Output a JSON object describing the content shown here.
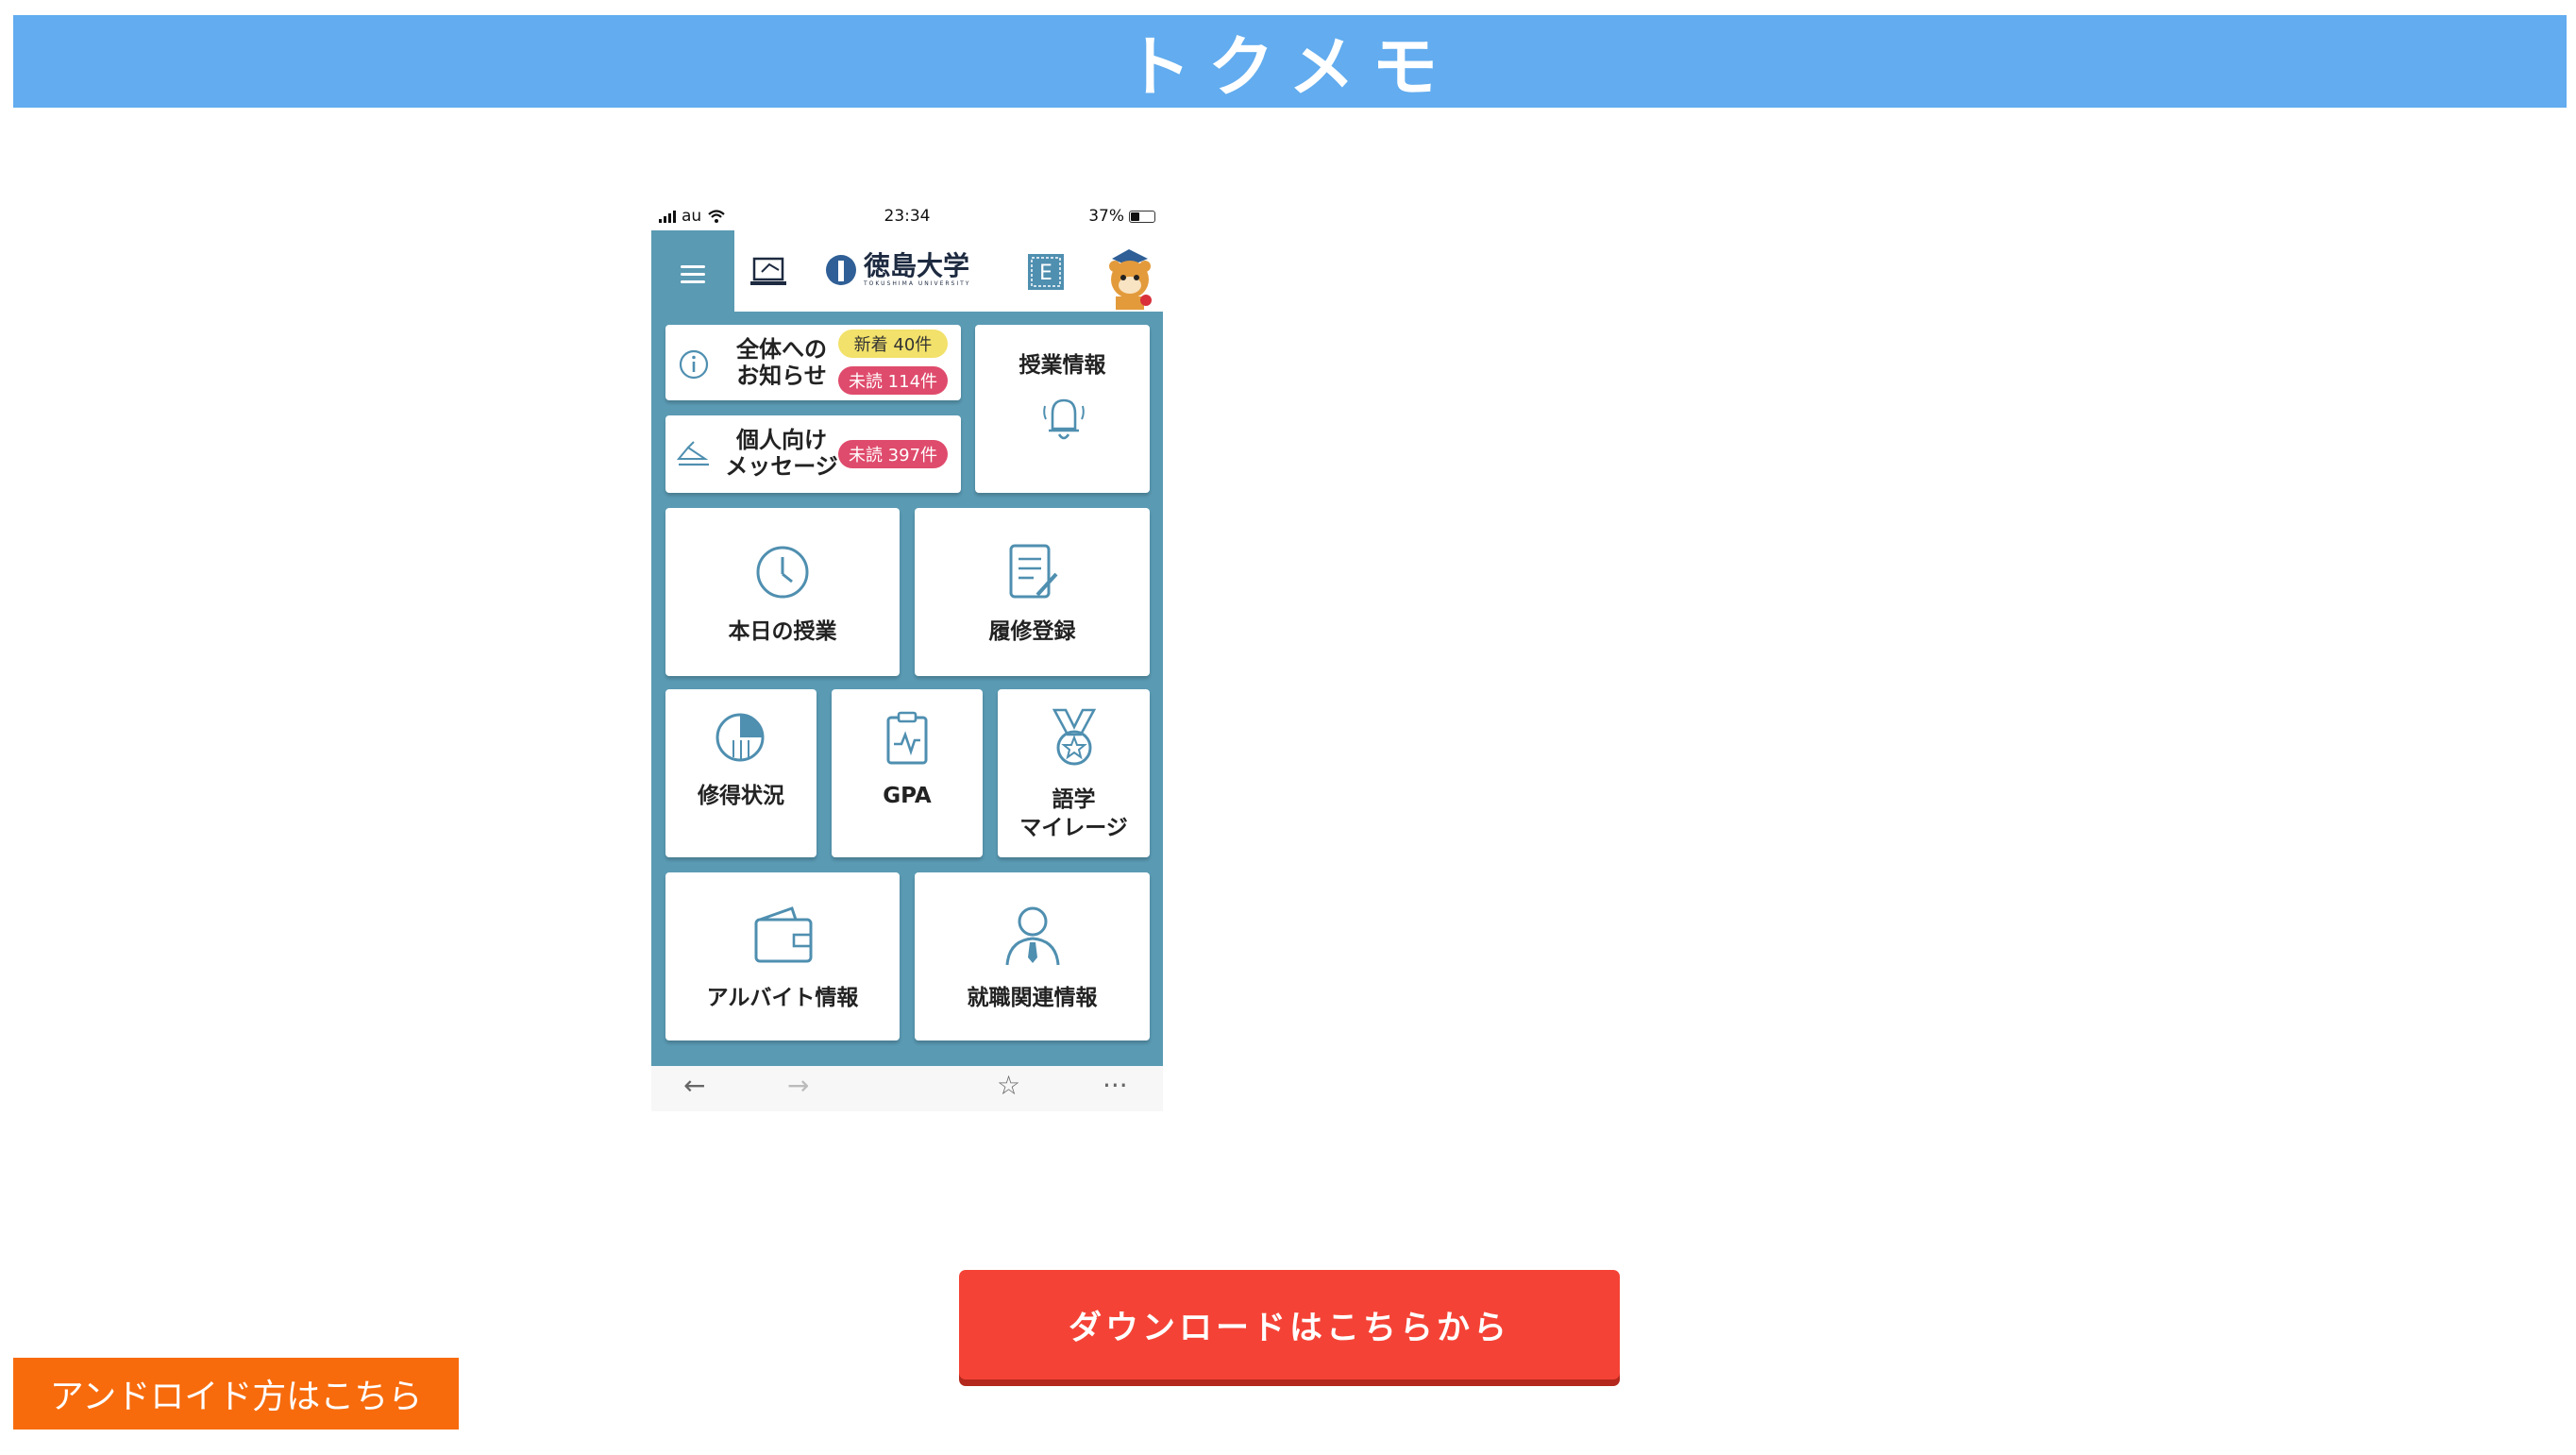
{
  "header": {
    "title": "トクメモ"
  },
  "phone": {
    "status": {
      "carrier": "au",
      "time": "23:34",
      "battery": "37%"
    },
    "logo": {
      "name_jp": "徳島大学",
      "name_en": "TOKUSHIMA UNIVERSITY"
    },
    "notices": {
      "all_label_line1": "全体への",
      "all_label_line2": "お知らせ",
      "new_badge": "新着 40件",
      "unread_badge": "未読 114件",
      "personal_label_line1": "個人向け",
      "personal_label_line2": "メッセージ",
      "personal_unread_badge": "未読 397件"
    },
    "tiles": {
      "class_info": "授業情報",
      "today_class": "本日の授業",
      "registration": "履修登録",
      "credits": "修得状況",
      "gpa": "GPA",
      "language_line1": "語学",
      "language_line2": "マイレージ",
      "parttime": "アルバイト情報",
      "career": "就職関連情報"
    },
    "bottom_nav": {
      "back": "←",
      "forward": "→",
      "bookmark": "☆",
      "more": "···"
    },
    "appbar_icons": [
      "tokumemo-icon",
      "e-learning-icon"
    ]
  },
  "buttons": {
    "download": "ダウンロードはこちらから",
    "android": "アンドロイド方はこちら"
  },
  "colors": {
    "header": "#62acef",
    "phone_accent": "#5a9ab3",
    "download": "#f44336",
    "android": "#f76b0c",
    "badge_new": "#f2e16a",
    "badge_unread": "#df4b6c"
  }
}
